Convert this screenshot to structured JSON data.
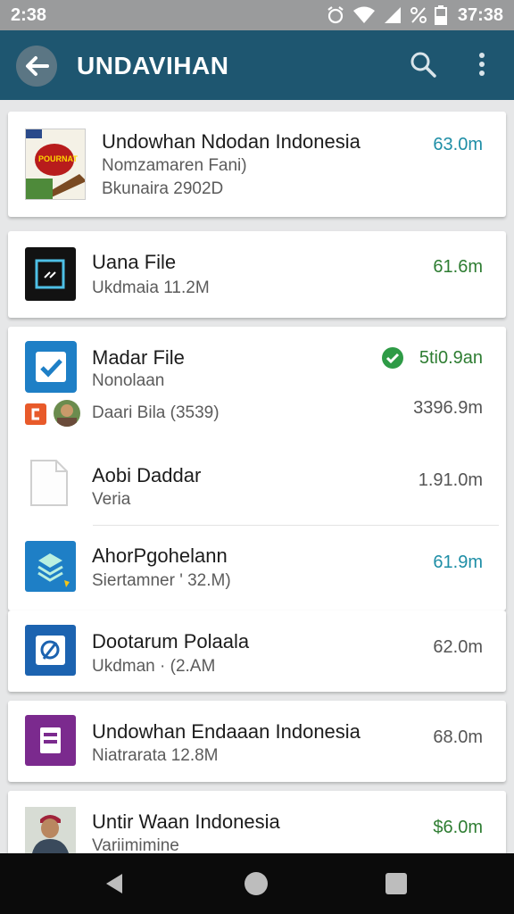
{
  "status_bar": {
    "time_left": "2:38",
    "time_right": "37:38",
    "icons": [
      "alarm-icon",
      "wifi-icon",
      "signal-icon",
      "percent-icon",
      "battery-icon"
    ]
  },
  "app_bar": {
    "title": "UNDAVIHAN"
  },
  "items": [
    {
      "title": "Undowhan Ndodan Indonesia",
      "line1": "Nomzamaren Fani)",
      "line2": "Bkunaira 2902D",
      "size": "63.0m",
      "size_color": "#1e8ea6"
    },
    {
      "title": "Uana File",
      "line1": "Ukdmaia 11.2M",
      "size": "61.6m",
      "size_color": "#2e7d32"
    },
    {
      "title": "Madar File",
      "line1": "Nonolaan",
      "line2": "Daari Bila  (3539)",
      "size": "5ti0.9an",
      "size_color": "#2e7d32",
      "size_secondary": "3396.9m"
    },
    {
      "title": "Aobi Daddar",
      "line1": "Veria",
      "size": "1.91.0m",
      "size_color": "#555555"
    },
    {
      "title": "AhorPgohelann",
      "line1": "Siertamner ' 32.M)",
      "size": "61.9m",
      "size_color": "#1e8ea6"
    },
    {
      "title": "Dootarum Polaala",
      "line1": "Ukdman  ·  (2.AM",
      "size": "62.0m",
      "size_color": "#555555"
    },
    {
      "title": "Undowhan Endaaan Indonesia",
      "line1": "Niatrarata  12.8M",
      "size": "68.0m",
      "size_color": "#555555"
    },
    {
      "title": "Untir Waan Indonesia",
      "line1": "Variimimine",
      "size": "$6.0m",
      "size_color": "#2e7d32"
    }
  ],
  "thumb_labels": {
    "book_cover_text": "POURNAT"
  },
  "colors": {
    "app_bar": "#1e5670",
    "status_bar": "#9a9b9c",
    "check_green": "#2e9b46",
    "accent_blue": "#1e7fc6",
    "accent_purple": "#7b2a8e"
  }
}
